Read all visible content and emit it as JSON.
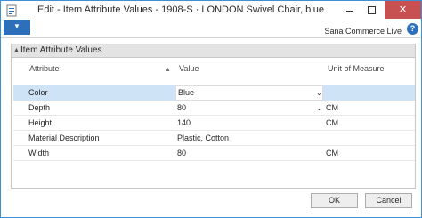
{
  "window": {
    "title": "Edit - Item Attribute Values - 1908-S · LONDON Swivel Chair, blue",
    "close_glyph": "✕",
    "icon": "page-icon"
  },
  "ribbon": {
    "menu_glyph": "▼",
    "company": "Sana Commerce Live",
    "help_glyph": "?"
  },
  "fasttab": {
    "caret": "▲",
    "title": "Item Attribute Values",
    "columns": {
      "attribute": "Attribute",
      "value": "Value",
      "unit": "Unit of Measure"
    },
    "sort_glyph": "▲",
    "dropdown_glyph": "⌄",
    "rows": [
      {
        "attribute": "Color",
        "value": "Blue",
        "unit": ""
      },
      {
        "attribute": "Depth",
        "value": "80",
        "unit": "CM"
      },
      {
        "attribute": "Height",
        "value": "140",
        "unit": "CM"
      },
      {
        "attribute": "Material Description",
        "value": "Plastic, Cotton",
        "unit": ""
      },
      {
        "attribute": "Width",
        "value": "80",
        "unit": "CM"
      }
    ]
  },
  "buttons": {
    "ok": "OK",
    "cancel": "Cancel"
  },
  "colors": {
    "accent": "#2d6fbb",
    "close": "#c75050",
    "selected_row": "#cfe3f7"
  }
}
